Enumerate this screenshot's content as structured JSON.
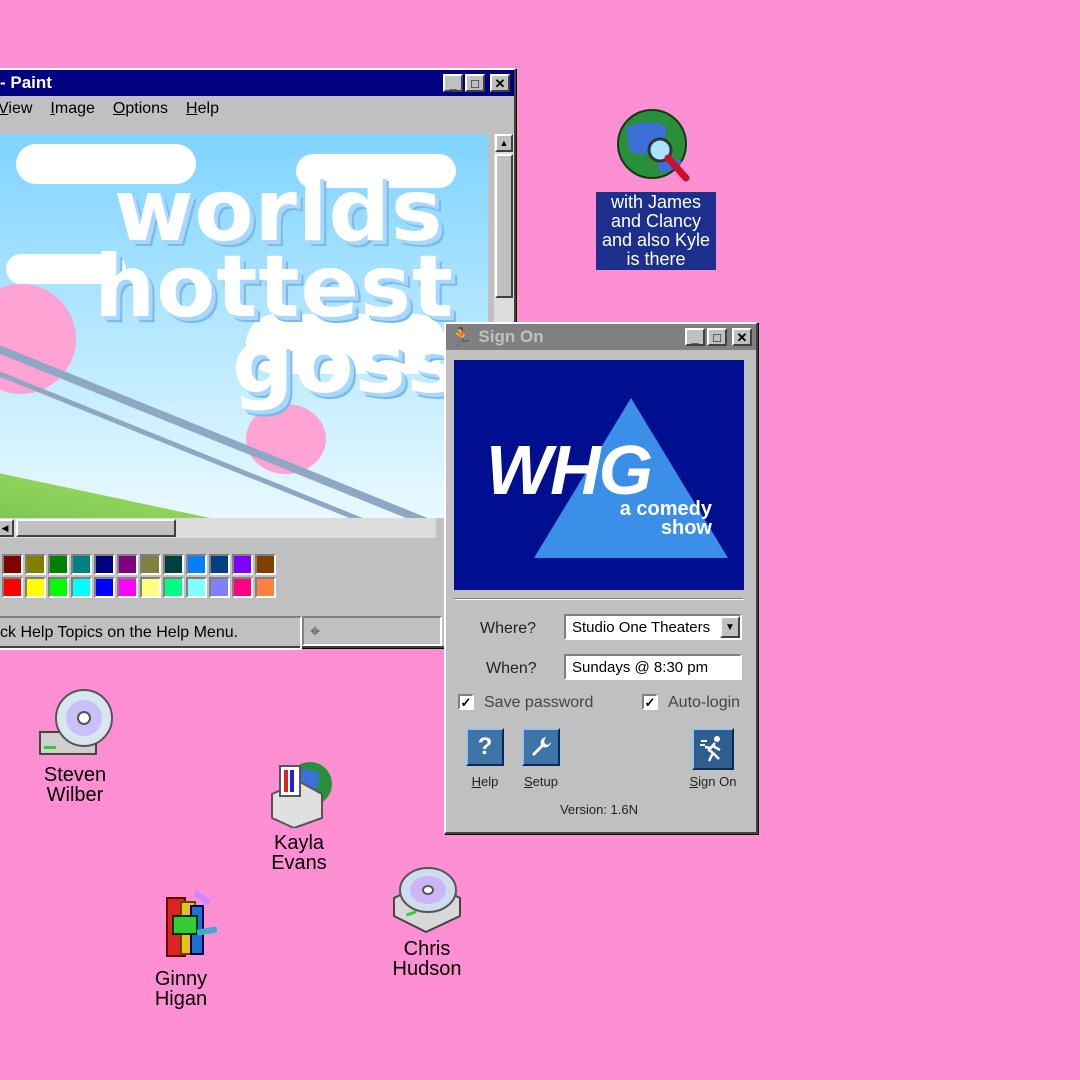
{
  "paint": {
    "title": "- Paint",
    "menus": [
      "View",
      "Image",
      "Options",
      "Help"
    ],
    "canvas_text": [
      "worlds",
      "hottest",
      "goss"
    ],
    "status": "ck Help Topics on the Help Menu.",
    "palette_row1": [
      "#800000",
      "#808000",
      "#008000",
      "#008080",
      "#000080",
      "#800080",
      "#808040",
      "#004040",
      "#0080ff",
      "#004080",
      "#8000ff",
      "#804000"
    ],
    "palette_row2": [
      "#ff0000",
      "#ffff00",
      "#00ff00",
      "#00ffff",
      "#0000ff",
      "#ff00ff",
      "#ffff80",
      "#00ff80",
      "#80ffff",
      "#8080ff",
      "#ff0080",
      "#ff8040"
    ]
  },
  "globe_icon": {
    "label": "with James and Clancy and also Kyle is there"
  },
  "signon": {
    "title": "Sign On",
    "logo_main": "WHG",
    "logo_sub_1": "a comedy",
    "logo_sub_2": "show",
    "where_label": "Where?",
    "where_value": "Studio One Theaters",
    "when_label": "When?",
    "when_value": "Sundays @ 8:30 pm",
    "save_password": "Save password",
    "auto_login": "Auto-login",
    "help_label": "Help",
    "setup_label": "Setup",
    "signon_label": "Sign On",
    "version": "Version: 1.6N"
  },
  "desktop_icons": {
    "steven": [
      "Steven",
      "Wilber"
    ],
    "kayla": [
      "Kayla",
      "Evans"
    ],
    "chris": [
      "Chris",
      "Hudson"
    ],
    "ginny": [
      "Ginny",
      "Higan"
    ]
  },
  "colors": {
    "desktop": "#ff8fd3",
    "title_active": "#000080",
    "logo_bg": "#000f8f",
    "logo_triangle": "#3b8fe8"
  }
}
